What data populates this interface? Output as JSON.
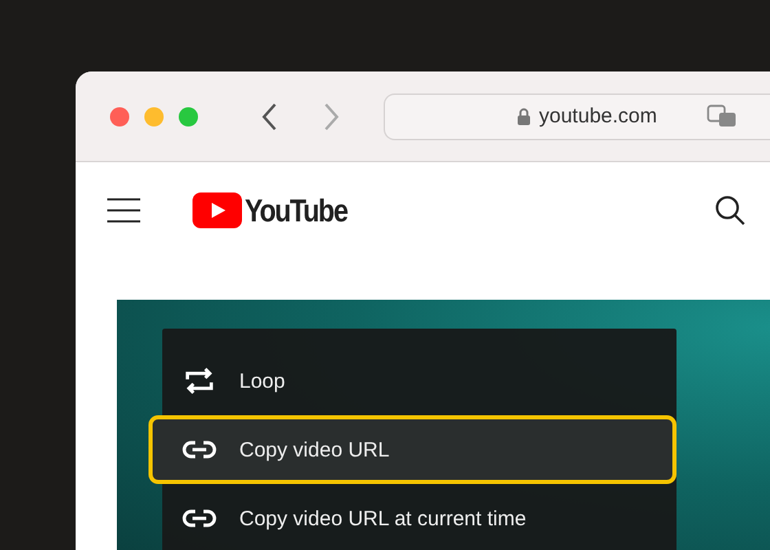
{
  "browser": {
    "address": "youtube.com",
    "secure": true
  },
  "page": {
    "logo_text": "YouTube"
  },
  "context_menu": {
    "items": [
      {
        "kind": "loop",
        "label": "Loop",
        "selected": false
      },
      {
        "kind": "link",
        "label": "Copy video URL",
        "selected": true
      },
      {
        "kind": "link",
        "label": "Copy video URL at current time",
        "selected": false
      }
    ]
  }
}
